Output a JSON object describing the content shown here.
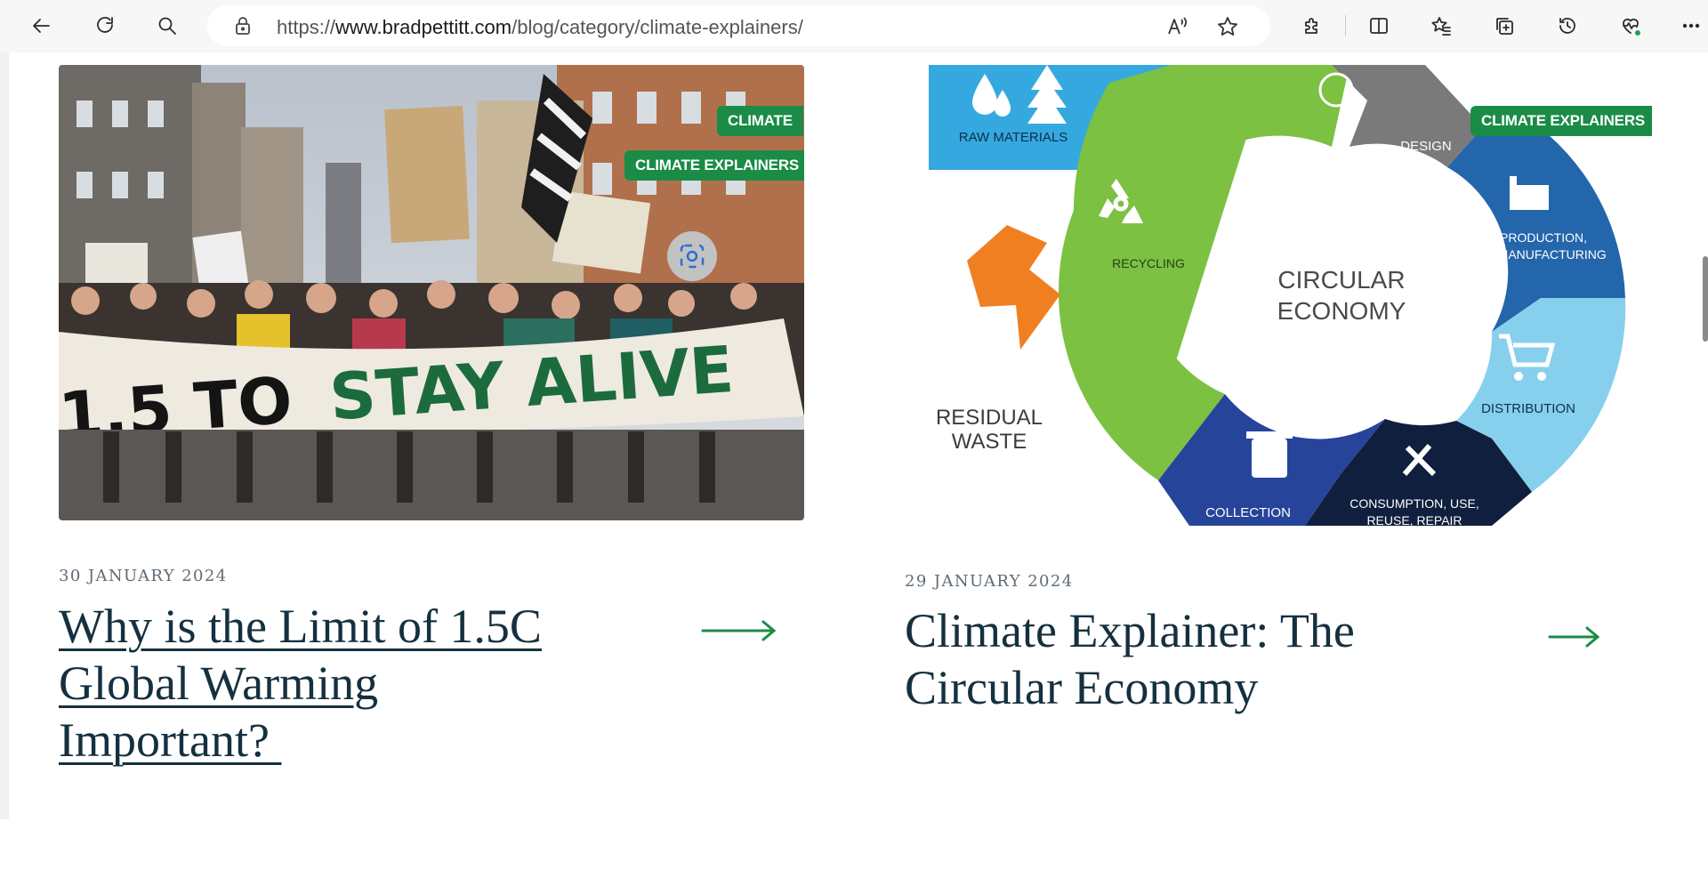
{
  "browser": {
    "url_prefix": "https://",
    "url_host": "www.bradpettitt.com",
    "url_path": "/blog/category/climate-explainers/"
  },
  "posts": [
    {
      "badges": [
        "CLIMATE",
        "CLIMATE EXPLAINERS"
      ],
      "image_banner_text": "1.5 TO STAY ALIVE",
      "date": "30 JANUARY 2024",
      "title_lines": [
        "Why is the Limit of 1.5C",
        "Global Warming",
        "Important? "
      ]
    },
    {
      "badges": [
        "CLIMATE EXPLAINERS"
      ],
      "diagram": {
        "center_line1": "CIRCULAR",
        "center_line2": "ECONOMY",
        "raw_materials": "RAW MATERIALS",
        "design": "DESIGN",
        "production_line1": "PRODUCTION,",
        "production_line2": "REMANUFACTURING",
        "distribution": "DISTRIBUTION",
        "consumption_line1": "CONSUMPTION, USE,",
        "consumption_line2": "REUSE, REPAIR",
        "collection": "COLLECTION",
        "recycling": "RECYCLING",
        "residual_line1": "RESIDUAL",
        "residual_line2": "WASTE"
      },
      "date": "29 JANUARY 2024",
      "title_lines": [
        "Climate Explainer: The",
        "Circular Economy"
      ]
    }
  ],
  "colors": {
    "badge_green": "#1a8c46",
    "title_navy": "#15303f",
    "circle_green": "#7cc142",
    "raw_blue": "#35a9df",
    "design_grey": "#7a7a7a",
    "production_blue": "#2466ab",
    "distribution_lightblue": "#86d0ee",
    "consumption_navy": "#0f1f3d",
    "collection_blue": "#27449b",
    "residual_orange": "#f07f22"
  }
}
